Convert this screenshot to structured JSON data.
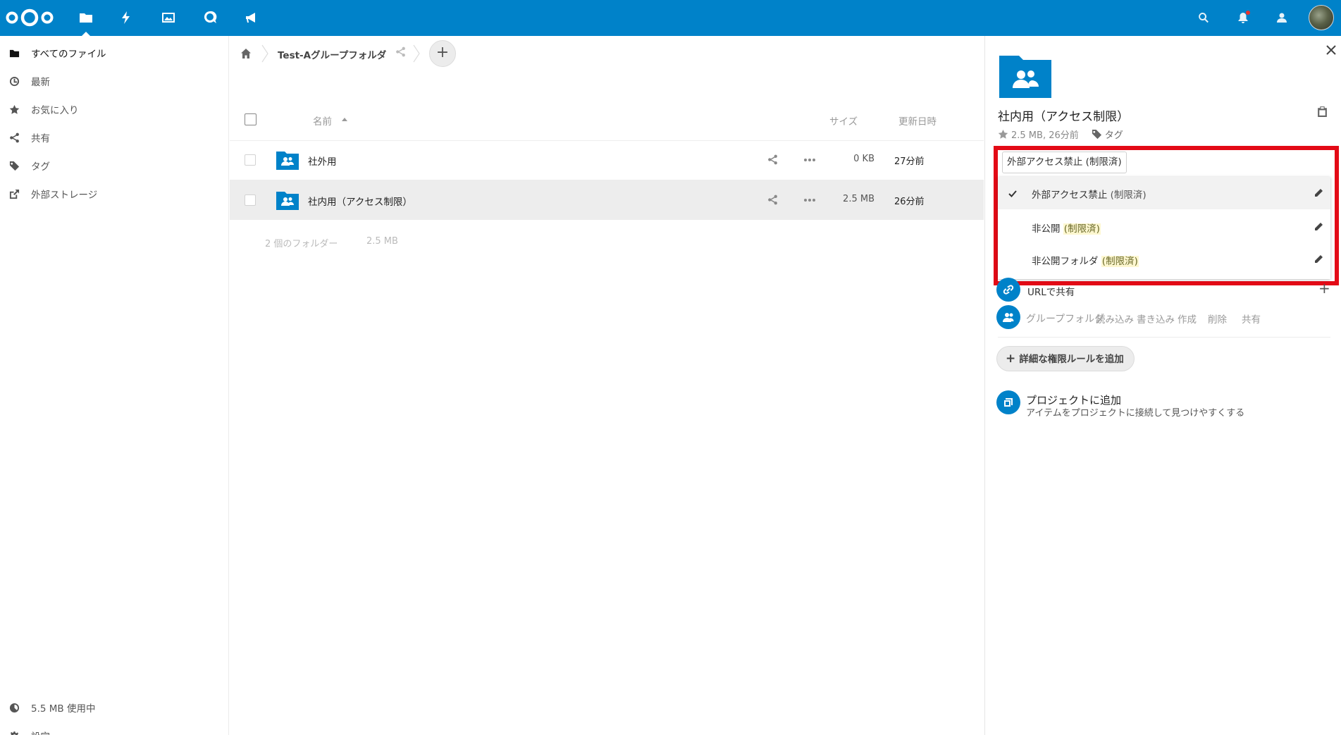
{
  "nav": {
    "items": [
      {
        "label": "すべてのファイル",
        "icon": "folder-icon"
      },
      {
        "label": "最新",
        "icon": "clock-icon"
      },
      {
        "label": "お気に入り",
        "icon": "star-icon"
      },
      {
        "label": "共有",
        "icon": "share-icon"
      },
      {
        "label": "タグ",
        "icon": "tag-icon"
      },
      {
        "label": "外部ストレージ",
        "icon": "external-link-icon"
      }
    ],
    "quota": "5.5 MB 使用中",
    "settings": "設定"
  },
  "breadcrumb": {
    "folder": "Test-Aグループフォルダ"
  },
  "table": {
    "headers": {
      "name": "名前",
      "size": "サイズ",
      "modified": "更新日時"
    },
    "rows": [
      {
        "name": "社外用",
        "size": "0 KB",
        "modified": "27分前",
        "selected": false
      },
      {
        "name": "社内用（アクセス制限）",
        "size": "2.5 MB",
        "modified": "26分前",
        "selected": true
      }
    ],
    "summary": {
      "folders": "2 個のフォルダー",
      "size": "2.5 MB"
    }
  },
  "sidebar": {
    "title": "社内用（アクセス制限）",
    "meta": "2.5 MB, 26分前",
    "tag_label": "タグ",
    "tag_input": "外部アクセス禁止 (制限済)",
    "dropdown": [
      {
        "name": "外部アクセス禁止",
        "suffix": "(制限済)",
        "checked": true,
        "highlight": false
      },
      {
        "name": "非公開",
        "suffix": "(制限済)",
        "checked": false,
        "highlight": true
      },
      {
        "name": "非公開フォルダ",
        "suffix": "(制限済)",
        "checked": false,
        "highlight": true
      }
    ],
    "share_link": "URLで共有",
    "groupfolder": "グループフォルダ",
    "permissions": [
      "読み込み",
      "書き込み",
      "作成",
      "削除",
      "共有"
    ],
    "add_rule": "詳細な権限ルールを追加",
    "project_title": "プロジェクトに追加",
    "project_sub": "アイテムをプロジェクトに接続して見つけやすくする"
  },
  "colors": {
    "brand": "#0082c9",
    "highlight_box": "#e30a16",
    "tag_highlight": "#fdf7d0"
  }
}
